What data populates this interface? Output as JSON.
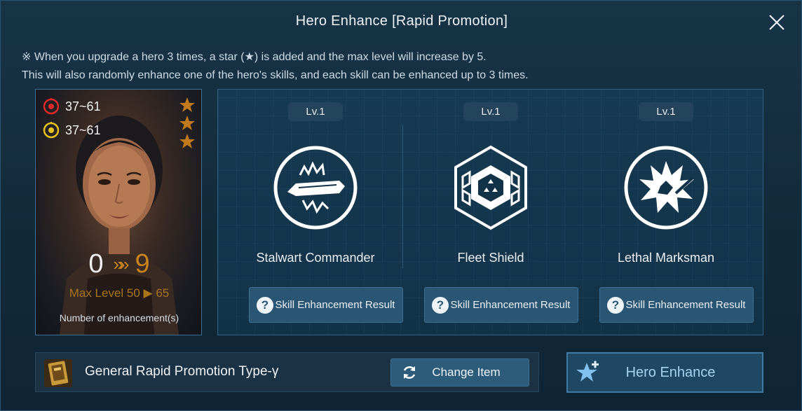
{
  "dialog": {
    "title": "Hero Enhance [Rapid Promotion]",
    "info_line1": "※ When you upgrade a hero 3 times, a star (★) is added and the max level will increase by 5.",
    "info_line2": "This will also randomly enhance one of the hero's skills, and each skill can be enhanced up to 3 times."
  },
  "hero": {
    "attack_range": "37~61",
    "defense_range": "37~61",
    "stars": 3,
    "enhance_current": "0",
    "enhance_arrows": "»»",
    "enhance_max": "9",
    "max_level_text": "Max Level 50 ▶ 65",
    "enhance_label": "Number of enhancement(s)"
  },
  "skills": [
    {
      "level": "Lv.1",
      "name": "Stalwart Commander",
      "icon": "commander-ship-icon",
      "button_label": "Skill Enhancement Result"
    },
    {
      "level": "Lv.1",
      "name": "Fleet Shield",
      "icon": "hex-shield-icon",
      "button_label": "Skill Enhancement Result"
    },
    {
      "level": "Lv.1",
      "name": "Lethal Marksman",
      "icon": "explosion-icon",
      "button_label": "Skill Enhancement Result"
    }
  ],
  "item": {
    "name": "General Rapid Promotion Type-γ",
    "change_label": "Change Item"
  },
  "actions": {
    "enhance_label": "Hero Enhance"
  },
  "colors": {
    "accent_orange": "#c9851c",
    "button_blue": "#2a5674",
    "enhance_text": "#a7d3f0"
  }
}
